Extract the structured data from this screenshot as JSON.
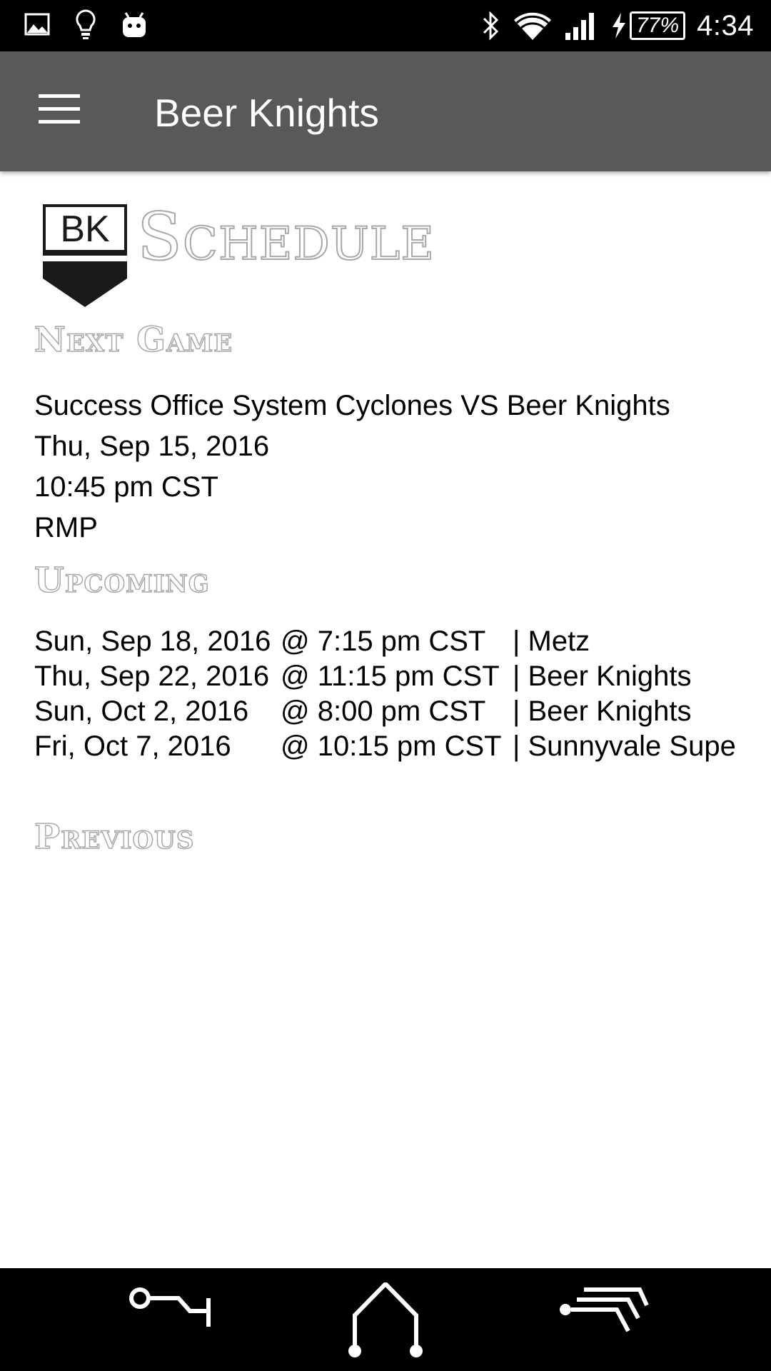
{
  "status_bar": {
    "notification_icons": [
      "image-icon",
      "lightbulb-icon",
      "android-icon"
    ],
    "battery": "77%",
    "time": "4:34"
  },
  "app_bar": {
    "menu_icon": "hamburger-menu-icon",
    "title": "Beer Knights"
  },
  "header": {
    "logo_text": "BK",
    "title": "Schedule"
  },
  "next_game": {
    "heading": "Next Game",
    "matchup": "Success Office System Cyclones VS Beer Knights",
    "date": "Thu, Sep 15, 2016",
    "time": "10:45 pm CST",
    "location": "RMP"
  },
  "upcoming": {
    "heading": "Upcoming",
    "games": [
      {
        "date": "Sun, Sep 18, 2016",
        "time": "@ 7:15 pm CST",
        "team": "| Metz"
      },
      {
        "date": "Thu, Sep 22, 2016",
        "time": "@ 11:15 pm CST",
        "team": "| Beer Knights"
      },
      {
        "date": "Sun, Oct 2, 2016",
        "time": "@ 8:00 pm CST",
        "team": "| Beer Knights"
      },
      {
        "date": "Fri, Oct 7, 2016",
        "time": "@ 10:15 pm CST",
        "team": "| Sunnyvale Supe"
      }
    ]
  },
  "previous": {
    "heading": "Previous"
  },
  "nav_bar": {
    "buttons": [
      "back-key-icon",
      "home-icon",
      "recents-icon"
    ]
  },
  "colors": {
    "status_bar_bg": "#000000",
    "app_bar_bg": "#595959",
    "outline_gray": "#a8a8a8",
    "nav_bar_bg": "#000000"
  }
}
